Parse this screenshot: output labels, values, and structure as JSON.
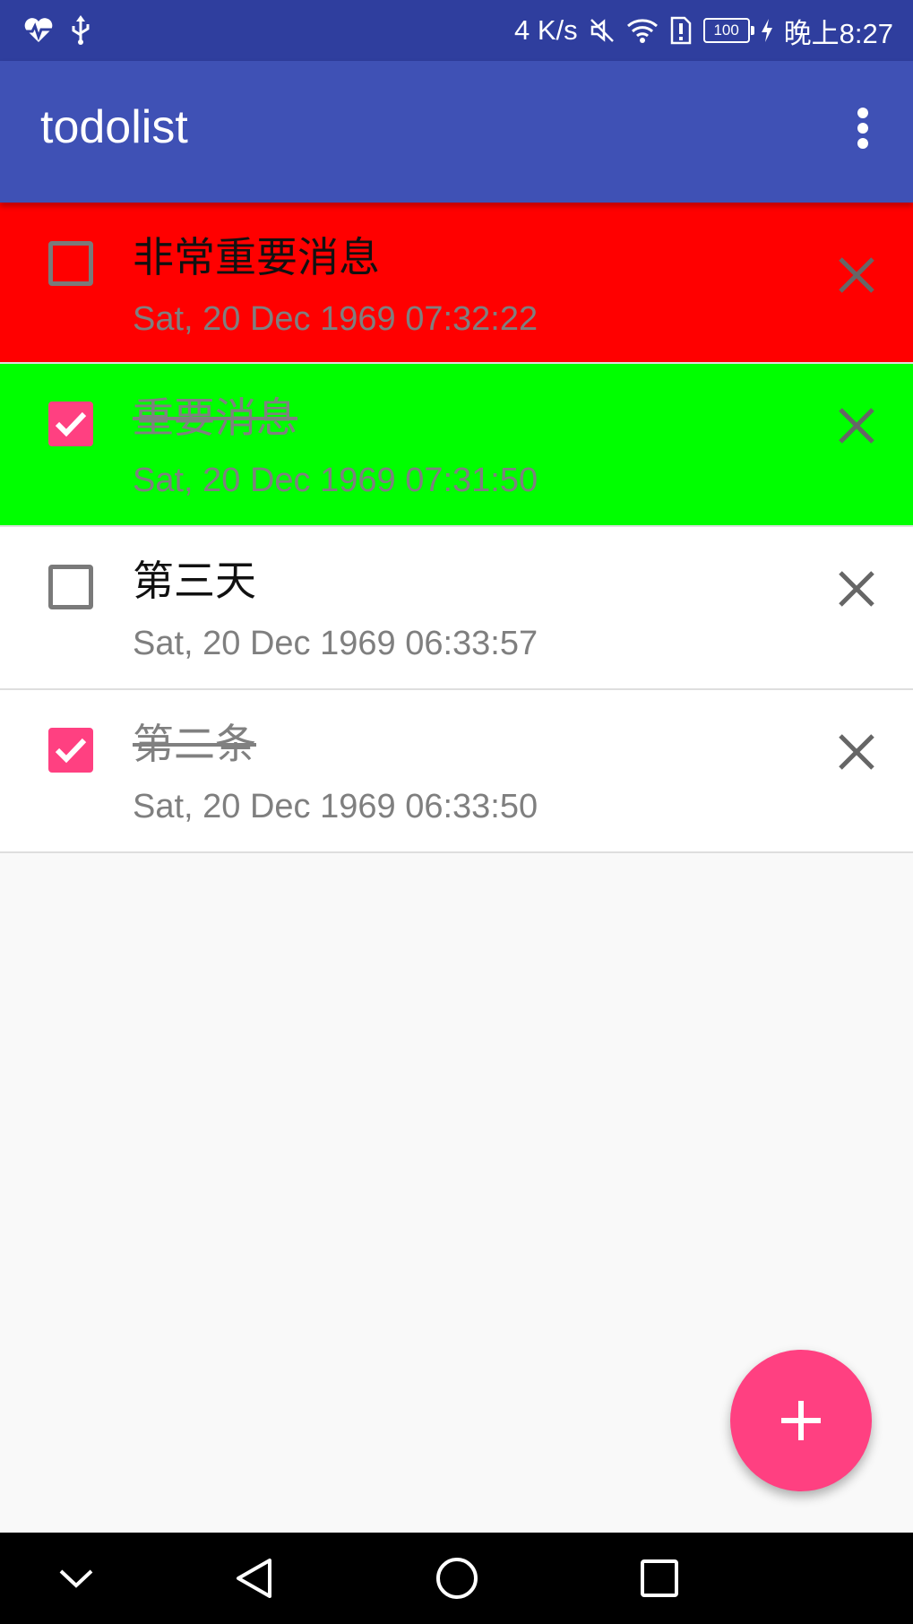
{
  "status_bar": {
    "left_icons": [
      "heart-rate-icon",
      "usb-icon"
    ],
    "network_speed": "4 K/s",
    "icons": [
      "mute-icon",
      "wifi-icon",
      "alert-icon",
      "charging-icon"
    ],
    "battery": "100",
    "time": "晚上8:27"
  },
  "app_bar": {
    "title": "todolist",
    "menu_icon": "more-vert-icon"
  },
  "todos": [
    {
      "title": "非常重要消息",
      "time": "Sat, 20 Dec 1969 07:32:22",
      "checked": false,
      "background": "#ff0000"
    },
    {
      "title": "重要消息",
      "time": "Sat, 20 Dec 1969 07:31:50",
      "checked": true,
      "background": "#00ff00"
    },
    {
      "title": "第三天",
      "time": "Sat, 20 Dec 1969 06:33:57",
      "checked": false,
      "background": "#ffffff"
    },
    {
      "title": "第二条",
      "time": "Sat, 20 Dec 1969 06:33:50",
      "checked": true,
      "background": "#ffffff"
    }
  ],
  "fab": {
    "icon": "plus-icon",
    "color": "#ff4081"
  },
  "nav_bar": {
    "buttons": [
      "chevron-down-icon",
      "back-icon",
      "home-icon",
      "recents-icon"
    ]
  },
  "colors": {
    "status_bar": "#2f3e9e",
    "app_bar": "#3f51b5",
    "accent": "#ff4081",
    "background": "#f9f9f9"
  }
}
